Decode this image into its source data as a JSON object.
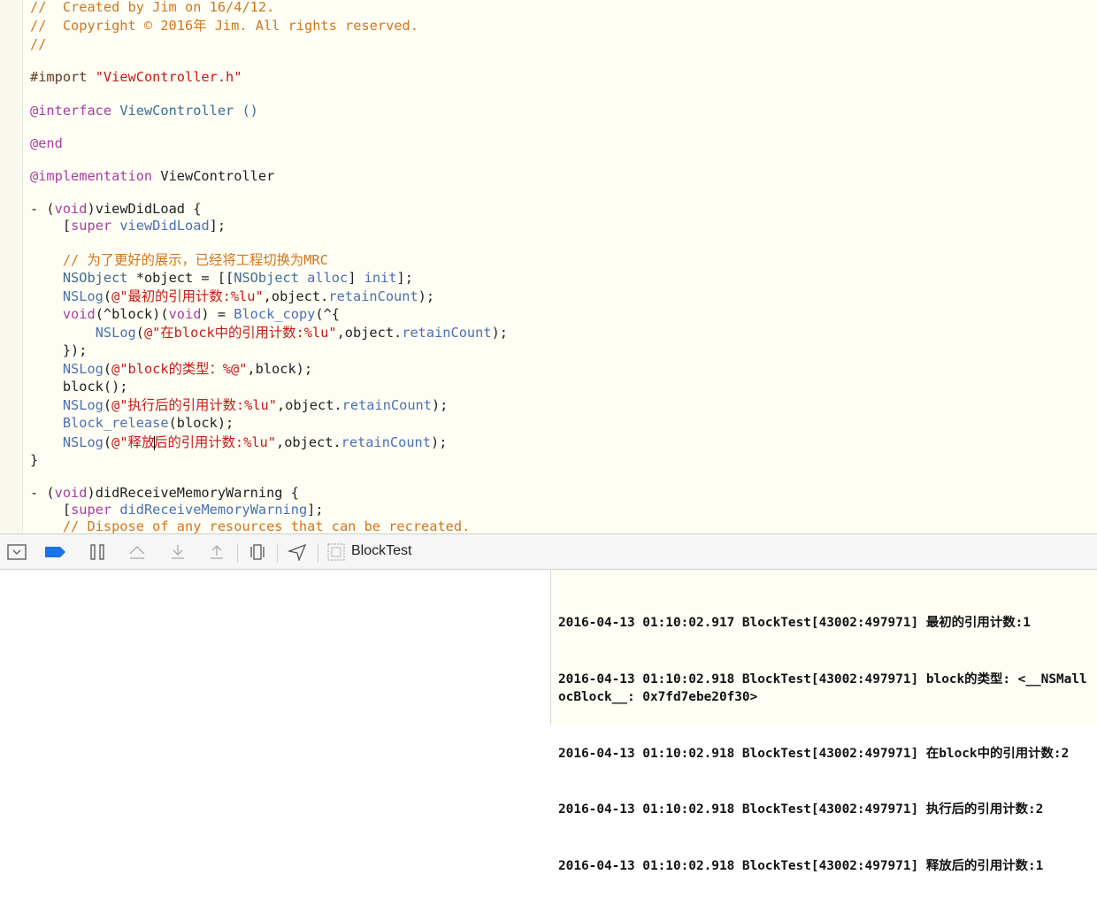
{
  "editor": {
    "lines": [
      [
        "c",
        "//  Created by Jim on 16/4/12."
      ],
      [
        "c",
        "//  Copyright © 2016年 Jim. All rights reserved."
      ],
      [
        "c",
        "//"
      ],
      [
        "blank",
        ""
      ],
      [
        "import",
        "#import ",
        "\"ViewController.h\""
      ],
      [
        "blank",
        ""
      ],
      [
        "iface",
        "@interface ",
        "ViewController ()"
      ],
      [
        "blank",
        ""
      ],
      [
        "end",
        "@end"
      ],
      [
        "blank",
        ""
      ],
      [
        "impl",
        "@implementation ",
        "ViewController"
      ],
      [
        "blank",
        ""
      ],
      [
        "method",
        "- (",
        "void",
        ")viewDidLoad {"
      ],
      [
        "supercall",
        "    [",
        "super",
        " ",
        "viewDidLoad",
        "];"
      ],
      [
        "blank",
        ""
      ],
      [
        "c",
        "    // 为了更好的展示，已经将工程切换为MRC"
      ],
      [
        "objdecl",
        "    ",
        "NSObject",
        " *object = [[",
        "NSObject",
        " ",
        "alloc",
        "] ",
        "init",
        "];"
      ],
      [
        "log1",
        "    ",
        "NSLog",
        "(",
        "@\"最初的引用计数:%lu\"",
        ",object.",
        "retainCount",
        ");"
      ],
      [
        "blockdecl",
        "    ",
        "void",
        "(^block)(",
        "void",
        ") = ",
        "Block_copy",
        "(^{"
      ],
      [
        "log1",
        "        ",
        "NSLog",
        "(",
        "@\"在block中的引用计数:%lu\"",
        ",object.",
        "retainCount",
        ");"
      ],
      [
        "plain",
        "    });"
      ],
      [
        "log2",
        "    ",
        "NSLog",
        "(",
        "@\"block的类型：%@\"",
        ",block);"
      ],
      [
        "plain",
        "    block();"
      ],
      [
        "log1",
        "    ",
        "NSLog",
        "(",
        "@\"执行后的引用计数:%lu\"",
        ",object.",
        "retainCount",
        ");"
      ],
      [
        "release",
        "    ",
        "Block_release",
        "(block);"
      ],
      [
        "logcursor",
        "    ",
        "NSLog",
        "(",
        "@\"释放",
        "后的引用计数:%lu\"",
        ",object.",
        "retainCount",
        ");"
      ],
      [
        "plain",
        "}"
      ],
      [
        "blank",
        ""
      ],
      [
        "method",
        "- (",
        "void",
        ")didReceiveMemoryWarning {"
      ],
      [
        "supercall",
        "    [",
        "super",
        " ",
        "didReceiveMemoryWarning",
        "];"
      ],
      [
        "c",
        "    // Dispose of any resources that can be recreated."
      ]
    ]
  },
  "toolbar": {
    "target_label": "BlockTest",
    "icons": [
      "hide-debug-area-icon",
      "breakpoints-toggle-icon",
      "pause-icon",
      "step-over-icon",
      "step-into-icon",
      "step-out-icon",
      "view-hierarchy-icon",
      "location-icon",
      "target-icon"
    ]
  },
  "console": {
    "lines": [
      "2016-04-13 01:10:02.917 BlockTest[43002:497971] 最初的引用计数:1",
      "2016-04-13 01:10:02.918 BlockTest[43002:497971] block的类型: <__NSMallocBlock__: 0x7fd7ebe20f30>",
      "2016-04-13 01:10:02.918 BlockTest[43002:497971] 在block中的引用计数:2",
      "2016-04-13 01:10:02.918 BlockTest[43002:497971] 执行后的引用计数:2",
      "2016-04-13 01:10:02.918 BlockTest[43002:497971] 释放后的引用计数:1"
    ]
  }
}
